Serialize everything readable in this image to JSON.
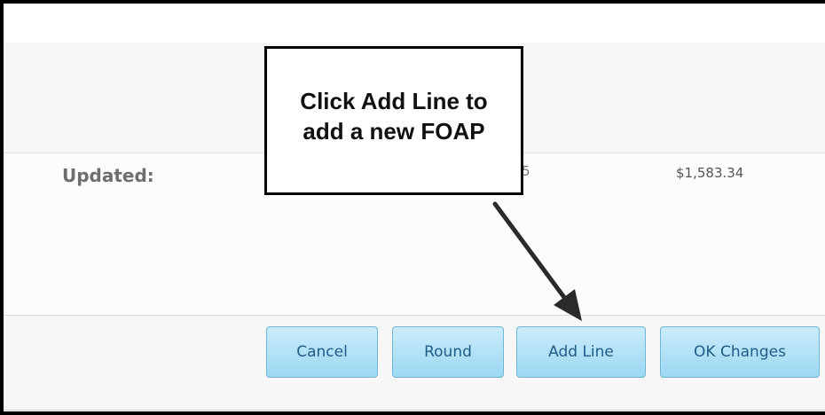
{
  "summary": {
    "updated_label": "Updated:",
    "updated_amount": "$1,583.34",
    "partial_digit": "5"
  },
  "buttons": {
    "cancel": "Cancel",
    "round": "Round",
    "add_line": "Add Line",
    "ok_changes": "OK Changes"
  },
  "callout": {
    "text": "Click Add Line to add a new FOAP"
  },
  "colors": {
    "button_fill": "#aee0f5",
    "button_text": "#1f5d8a",
    "button_border": "#6fb7d6"
  },
  "icons": {
    "arrow": "arrow-down-right"
  }
}
